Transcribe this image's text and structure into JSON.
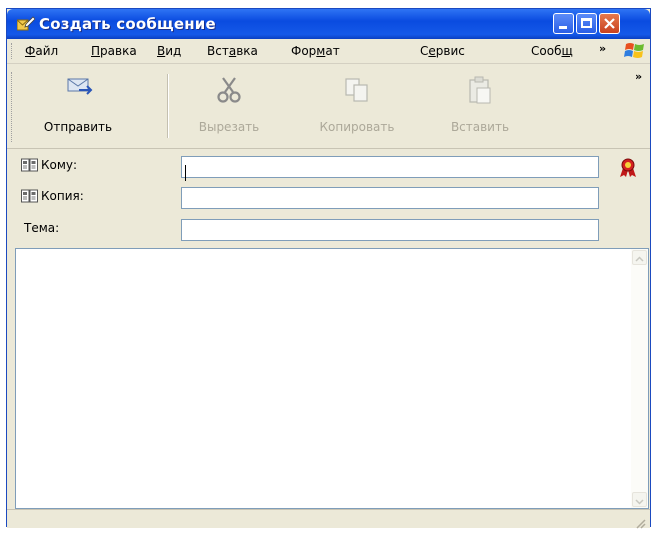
{
  "window": {
    "title": "Создать сообщение"
  },
  "menu": {
    "items": [
      {
        "pre": "",
        "u": "Ф",
        "post": "айл"
      },
      {
        "pre": "",
        "u": "П",
        "post": "равка"
      },
      {
        "pre": "",
        "u": "В",
        "post": "ид"
      },
      {
        "pre": "Вст",
        "u": "а",
        "post": "вка"
      },
      {
        "pre": "Фор",
        "u": "м",
        "post": "ат"
      },
      {
        "pre": "С",
        "u": "е",
        "post": "рвис"
      },
      {
        "pre": "Сооб",
        "u": "щ",
        "post": ""
      }
    ],
    "overflow": "»"
  },
  "toolbar": {
    "send_label": "Отправить",
    "cut_label": "Вырезать",
    "copy_label": "Копировать",
    "paste_label": "Вставить",
    "overflow": "»"
  },
  "header": {
    "to_label": "Кому:",
    "to_value": "",
    "cc_label": "Копия:",
    "cc_value": "",
    "subject_label": "Тема:",
    "subject_value": ""
  },
  "message": {
    "body": ""
  },
  "icons": [
    "compose-window-icon",
    "minimize-icon",
    "maximize-icon",
    "close-icon",
    "windows-logo-icon",
    "send-icon",
    "scissors-icon",
    "copy-icon",
    "paste-icon",
    "address-book-icon",
    "security-ribbon-icon",
    "scroll-up-arrow-icon",
    "scroll-down-arrow-icon",
    "resize-grip-icon"
  ],
  "colors": {
    "titlebar": "#0a4be0",
    "chrome": "#ece9d8",
    "input_border": "#7f9db9",
    "disabled_text": "#aca899"
  }
}
